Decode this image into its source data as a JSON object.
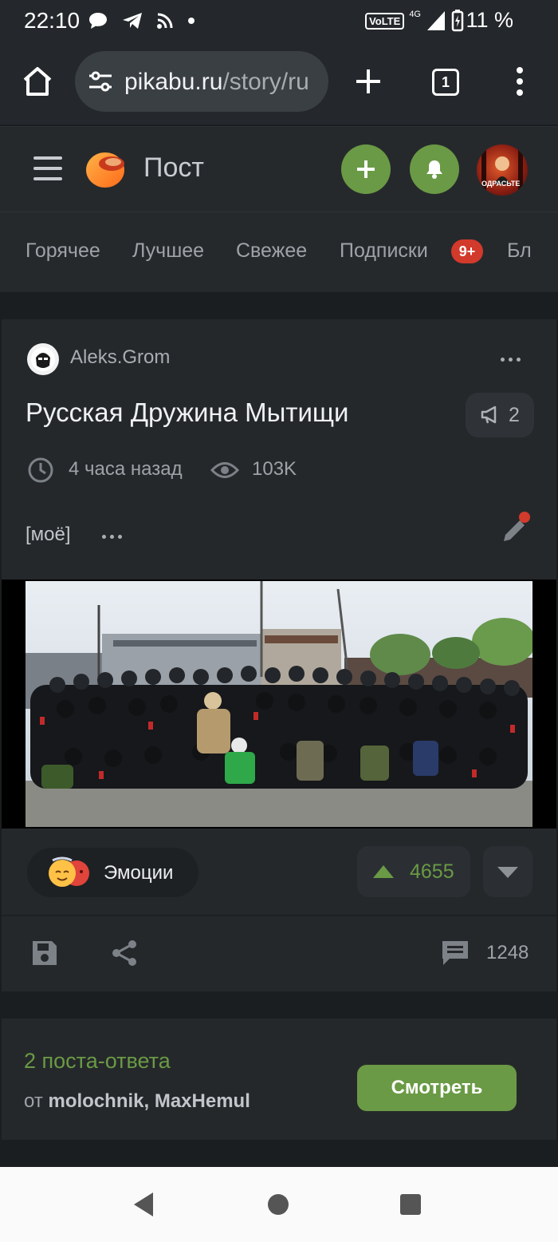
{
  "status_bar": {
    "time": "22:10",
    "network": "VoLTE",
    "network_type": "4G",
    "battery": "11 %",
    "icons": [
      "chat-bubble-icon",
      "telegram-icon",
      "rss-icon",
      "dot-icon",
      "signal-icon",
      "battery-icon"
    ]
  },
  "browser": {
    "url_domain": "pikabu.ru",
    "url_path": "/story/ru",
    "tab_count": "1"
  },
  "site": {
    "title": "Пост",
    "brand_color": "#6a9a45"
  },
  "nav_tabs": [
    {
      "label": "Горячее"
    },
    {
      "label": "Лучшее"
    },
    {
      "label": "Свежее"
    },
    {
      "label": "Подписки"
    },
    {
      "label": "Бл"
    }
  ],
  "subscriptions_badge": "9+",
  "post": {
    "author": "Aleks.Grom",
    "title": "Русская Дружина Мытищи",
    "replies_count": "2",
    "time_ago": "4 часа назад",
    "views": "103K",
    "tag": "[моё]",
    "emotions_label": "Эмоции",
    "rating": "4655",
    "comments": "1248"
  },
  "reply_posts": {
    "title": "2 поста-ответа",
    "from_prefix": "от",
    "authors": "molochnik, MaxHemul",
    "view_button": "Смотреть"
  },
  "avatar_label": "ОДРАСЬТЕ"
}
